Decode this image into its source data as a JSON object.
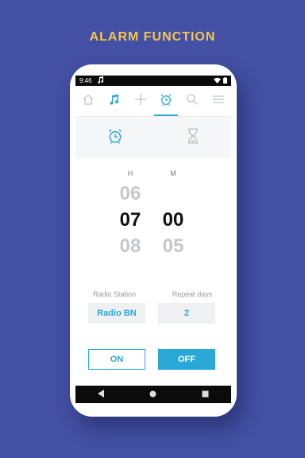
{
  "headline": "ALARM FUNCTION",
  "status": {
    "time": "9:46",
    "note_icon": "music-note-icon",
    "signal": "wifi-icon",
    "battery": "battery-icon"
  },
  "toolbar": {
    "items": [
      {
        "icon": "home-icon"
      },
      {
        "icon": "music-note-icon"
      },
      {
        "icon": "plus-icon"
      },
      {
        "icon": "alarm-clock-icon",
        "active": true
      },
      {
        "icon": "search-icon"
      },
      {
        "icon": "menu-icon"
      }
    ]
  },
  "modes": [
    {
      "icon": "alarm-clock-icon",
      "active": true
    },
    {
      "icon": "hourglass-icon"
    }
  ],
  "picker": {
    "hour_label": "H",
    "minute_label": "M",
    "hour_prev": "06",
    "hour_selected": "07",
    "hour_next": "08",
    "minute_prev": "",
    "minute_selected": "00",
    "minute_next": "05"
  },
  "settings": {
    "radio_label": "Radio Station",
    "radio_value": "Radio BN",
    "repeat_label": "Repeat days",
    "repeat_value": "2"
  },
  "buttons": {
    "on": "ON",
    "off": "OFF"
  },
  "colors": {
    "background": "#4350a3",
    "accent": "#29a8d8",
    "headline": "#f6c64a"
  }
}
